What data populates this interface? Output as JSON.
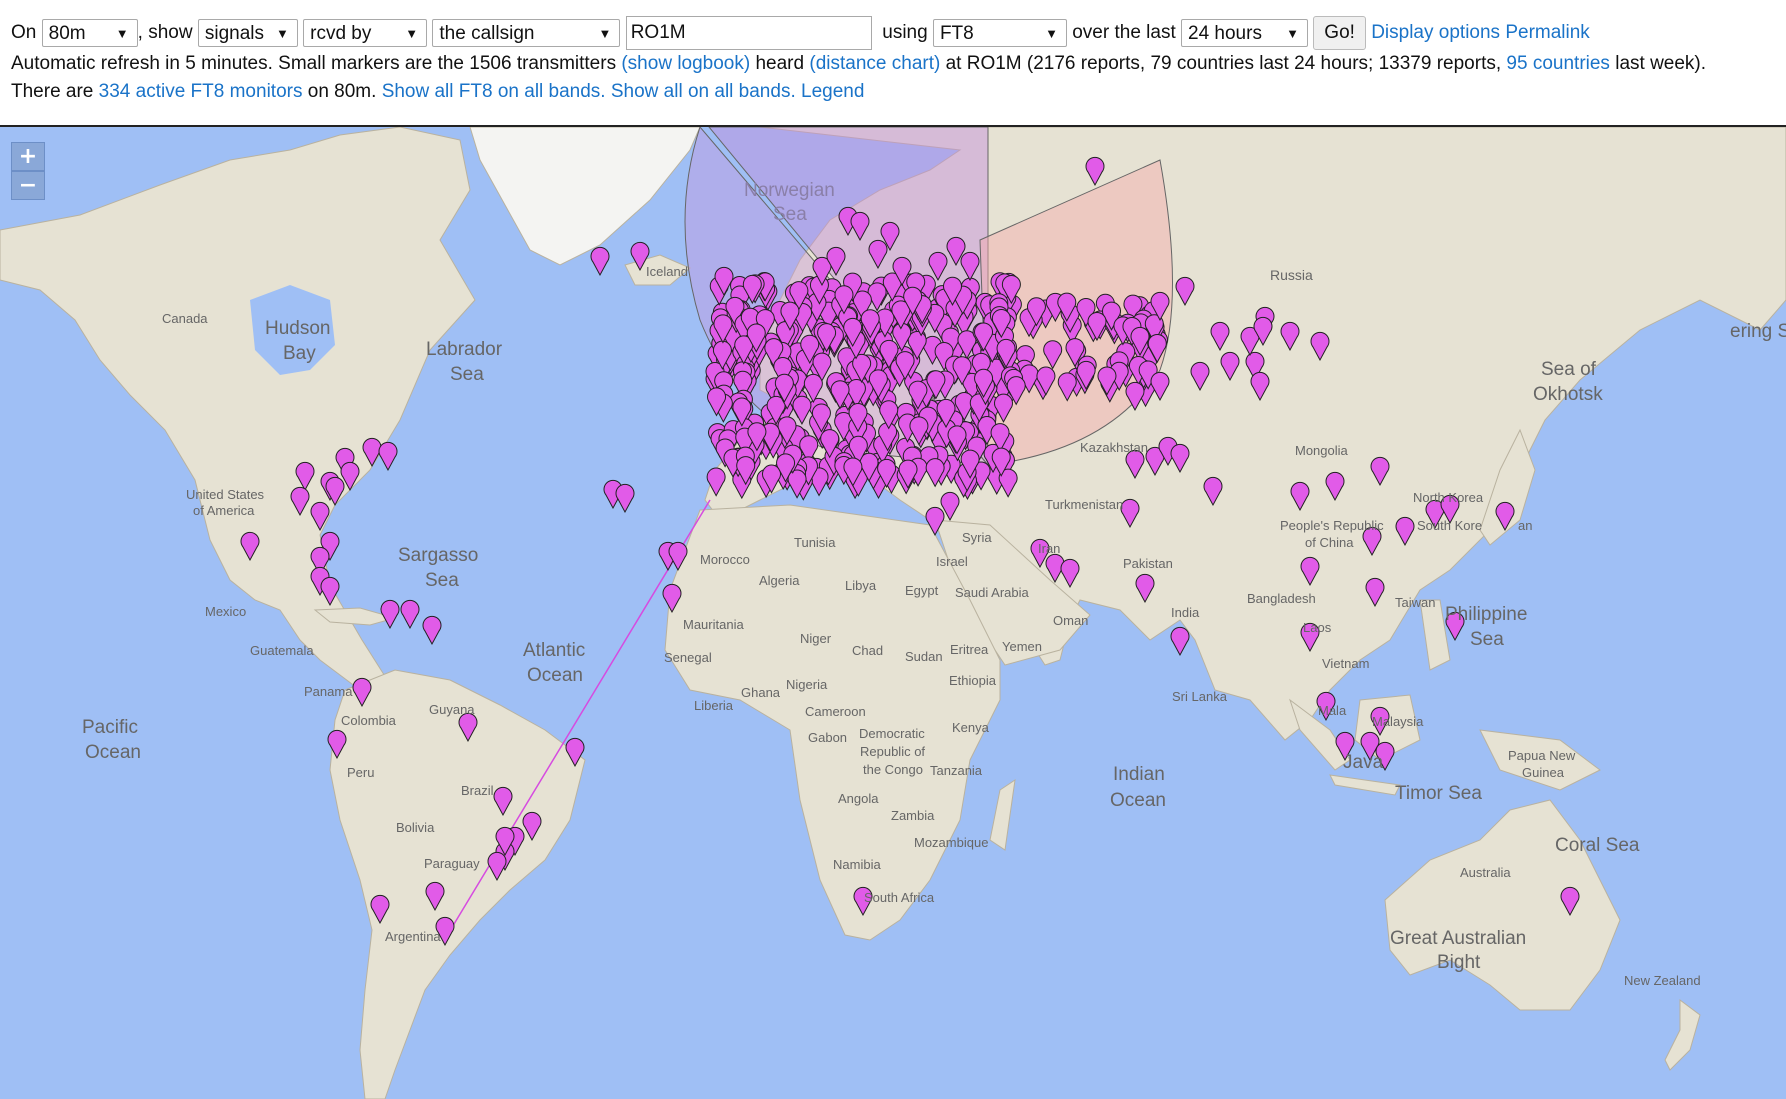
{
  "controls": {
    "on_label": "On",
    "band_value": "80m",
    "show_label": ", show",
    "show_value": "signals",
    "direction_value": "rcvd by",
    "target_value": "the callsign",
    "callsign_value": "RO1M",
    "using_label": "using",
    "mode_value": "FT8",
    "over_label": "over the last",
    "period_value": "24 hours",
    "go_label": "Go!",
    "display_options_label": "Display options",
    "permalink_label": "Permalink"
  },
  "info": {
    "l2_a": "Automatic refresh in 5 minutes. Small markers are the 1506 transmitters",
    "l2_link1": "(show logbook)",
    "l2_b": "heard",
    "l2_link2": "(distance chart)",
    "l2_c": "at RO1M (2176 reports, 79 countries last 24 hours; 13379 reports,",
    "l2_link3": "95 countries",
    "l2_d": "last week).",
    "l3_a": "There are",
    "l3_link1": "334 active FT8 monitors",
    "l3_b": "on 80m.",
    "l3_link2": "Show all FT8 on all bands.",
    "l3_link3": "Show all on all bands.",
    "l3_link4": "Legend"
  },
  "map": {
    "zoom_in": "+",
    "zoom_out": "−",
    "marker_color": "#e15be8",
    "land_color": "#e7e3d6",
    "water_color": "#9fbff5",
    "labels": {
      "norwegian": "Norwegian",
      "sea": "Sea",
      "iceland": "Iceland",
      "canada": "Canada",
      "hudson": "Hudson",
      "bay": "Bay",
      "labrador": "Labrador",
      "russia": "Russia",
      "bering": "ering S",
      "okhotsk1": "Sea of",
      "okhotsk2": "Okhotsk",
      "kazakhstan": "Kazakhstan",
      "mongolia": "Mongolia",
      "usa1": "United States",
      "usa2": "of America",
      "sargasso": "Sargasso",
      "turkmenistan": "Turkmenistan",
      "north_korea": "North Korea",
      "south_korea": "South Kore",
      "japan": "an",
      "prc1": "People's Republic",
      "prc2": "of China",
      "iran": "Iran",
      "pakistan": "Pakistan",
      "syria": "Syria",
      "israel": "Israel",
      "tunisia": "Tunisia",
      "morocco": "Morocco",
      "algeria": "Algeria",
      "libya": "Libya",
      "egypt": "Egypt",
      "saudi": "Saudi Arabia",
      "oman": "Oman",
      "yemen": "Yemen",
      "mexico": "Mexico",
      "guatemala": "Guatemala",
      "atlantic": "Atlantic",
      "ocean": "Ocean",
      "pacific": "Pacific",
      "india": "India",
      "bangladesh": "Bangladesh",
      "taiwan": "Taiwan",
      "philippine": "Philippine",
      "laos": "Laos",
      "vietnam": "Vietnam",
      "mauritania": "Mauritania",
      "niger": "Niger",
      "chad": "Chad",
      "sudan": "Sudan",
      "eritrea": "Eritrea",
      "senegal": "Senegal",
      "ethiopia": "Ethiopia",
      "panama": "Panama",
      "guyana": "Guyana",
      "colombia": "Colombia",
      "ghana": "Ghana",
      "nigeria": "Nigeria",
      "liberia": "Liberia",
      "cameroon": "Cameroon",
      "sri_lanka": "Sri Lanka",
      "malaysia_a": "Mala",
      "malaysia_b": "Malaysia",
      "gabon": "Gabon",
      "kenya": "Kenya",
      "drc1": "Democratic",
      "drc2": "Republic of",
      "drc3": "the Congo",
      "tanzania": "Tanzania",
      "peru": "Peru",
      "brazil": "Brazil",
      "indian": "Indian",
      "java": "Java",
      "png1": "Papua New",
      "png2": "Guinea",
      "timor": "Timor Sea",
      "bolivia": "Bolivia",
      "angola": "Angola",
      "zambia": "Zambia",
      "mozambique": "Mozambique",
      "paraguay": "Paraguay",
      "namibia": "Namibia",
      "coral": "Coral Sea",
      "australia": "Australia",
      "south_africa": "South Africa",
      "argentina": "Argentina",
      "gab1": "Great Australian",
      "gab2": "Bight",
      "new_zealand": "New Zealand"
    }
  }
}
